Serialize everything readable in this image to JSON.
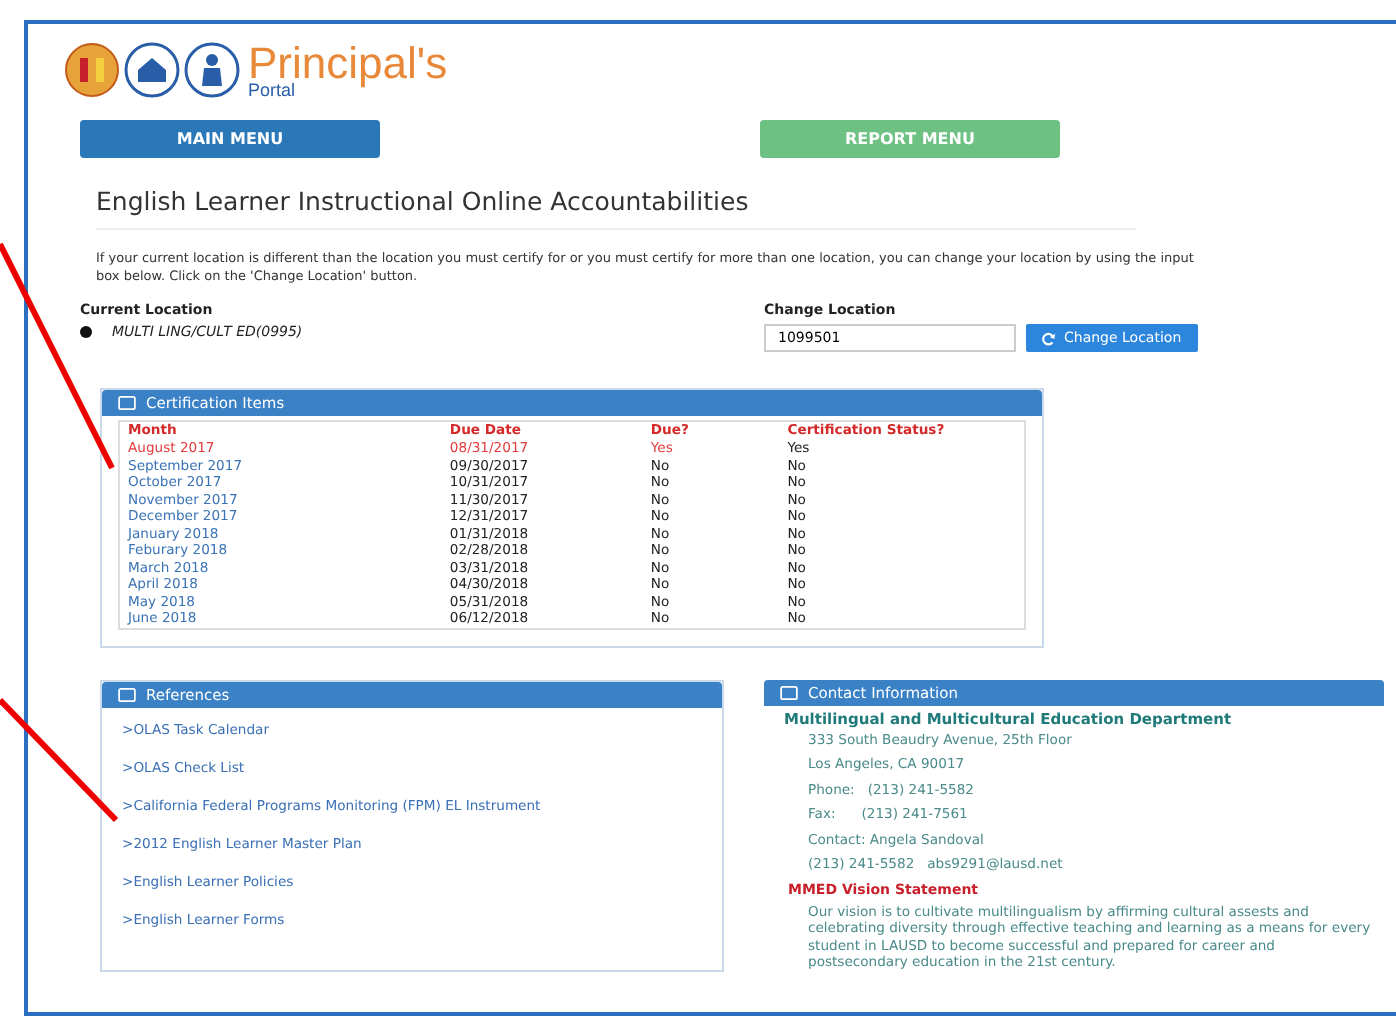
{
  "header": {
    "logo_title": "Principal's",
    "logo_subtitle": "Portal"
  },
  "nav_buttons": [
    {
      "label": "MAIN MENU",
      "kind": "primary"
    },
    {
      "label": "REPORT MENU",
      "kind": "success"
    }
  ],
  "page_title": "English Learner Instructional Online Accountabilities",
  "intro": "If your current location is different than the location you must certify for or you must certify for more than one location, you can change your location by using the input box below. Click on the 'Change Location' button.",
  "current_location": {
    "label": "Current Location",
    "value": "MULTI LING/CULT ED(0995)"
  },
  "change_location": {
    "label": "Change Location",
    "value": "1099501",
    "button": "Change Location"
  },
  "certification": {
    "title": "Certification Items",
    "columns": [
      "Month",
      "Due Date",
      "Due?",
      "Certification Status?"
    ],
    "rows": [
      {
        "month": "August 2017",
        "due_date": "08/31/2017",
        "due": "Yes",
        "status": "Yes",
        "overdue": true
      },
      {
        "month": "September 2017",
        "due_date": "09/30/2017",
        "due": "No",
        "status": "No",
        "overdue": false
      },
      {
        "month": "October 2017",
        "due_date": "10/31/2017",
        "due": "No",
        "status": "No",
        "overdue": false
      },
      {
        "month": "November 2017",
        "due_date": "11/30/2017",
        "due": "No",
        "status": "No",
        "overdue": false
      },
      {
        "month": "December 2017",
        "due_date": "12/31/2017",
        "due": "No",
        "status": "No",
        "overdue": false
      },
      {
        "month": "January 2018",
        "due_date": "01/31/2018",
        "due": "No",
        "status": "No",
        "overdue": false
      },
      {
        "month": "Feburary 2018",
        "due_date": "02/28/2018",
        "due": "No",
        "status": "No",
        "overdue": false
      },
      {
        "month": "March 2018",
        "due_date": "03/31/2018",
        "due": "No",
        "status": "No",
        "overdue": false
      },
      {
        "month": "April 2018",
        "due_date": "04/30/2018",
        "due": "No",
        "status": "No",
        "overdue": false
      },
      {
        "month": "May 2018",
        "due_date": "05/31/2018",
        "due": "No",
        "status": "No",
        "overdue": false
      },
      {
        "month": "June 2018",
        "due_date": "06/12/2018",
        "due": "No",
        "status": "No",
        "overdue": false
      }
    ]
  },
  "references": {
    "title": "References",
    "links": [
      ">OLAS Task Calendar",
      ">OLAS Check List",
      ">California Federal Programs Monitoring (FPM) EL Instrument",
      ">2012 English Learner Master Plan",
      ">English Learner Policies",
      ">English Learner Forms"
    ]
  },
  "contact": {
    "title": "Contact Information",
    "department": "Multilingual and Multicultural Education Department",
    "lines": [
      "333 South Beaudry Avenue, 25th Floor",
      "Los Angeles, CA 90017",
      "Phone:   (213) 241-5582",
      "Fax:      (213) 241-7561",
      "Contact: Angela Sandoval",
      "(213) 241-5582   abs9291@lausd.net"
    ],
    "vision_title": "MMED Vision Statement",
    "vision": "Our vision is to cultivate multilingualism by affirming cultural assests and celebrating diversity through effective teaching and learning as a means for every student in LAUSD to become successful and prepared for career and postsecondary education in the 21st century."
  }
}
